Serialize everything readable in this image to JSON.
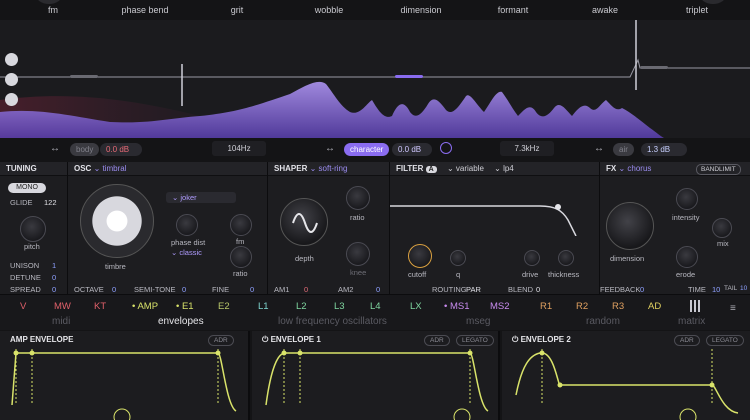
{
  "top_params": [
    "fm",
    "phase bend",
    "grit",
    "wobble",
    "dimension",
    "formant",
    "awake",
    "triplet"
  ],
  "spectrum": {
    "body_label": "body",
    "body_value": "0.0 dB",
    "freq1": "104Hz",
    "character_label": "character",
    "character_value": "0.0 dB",
    "freq2": "7.3kHz",
    "air_label": "air",
    "air_value": "1.3 dB"
  },
  "tuning": {
    "title": "TUNING",
    "mode": "MONO",
    "glide_label": "GLIDE",
    "glide_value": "122",
    "pitch_label": "pitch",
    "unison_label": "UNISON",
    "unison_value": "1",
    "detune_label": "DETUNE",
    "detune_value": "0",
    "spread_label": "SPREAD",
    "spread_value": "0"
  },
  "osc": {
    "title": "OSC",
    "type": "timbral",
    "preset": "joker",
    "timbre_label": "timbre",
    "phase_label": "phase dist",
    "phase_mode": "classic",
    "fm_label": "fm",
    "ratio_label": "ratio",
    "octave_label": "OCTAVE",
    "octave_value": "0",
    "semitone_label": "SEMI-TONE",
    "semitone_value": "0",
    "fine_label": "FINE",
    "fine_value": "0"
  },
  "shaper": {
    "title": "SHAPER",
    "type": "soft-ring",
    "depth_label": "depth",
    "ratio_label": "ratio",
    "knee_label": "knee",
    "am1_label": "AM1",
    "am1_value": "0",
    "am2_label": "AM2",
    "am2_value": "0"
  },
  "filter": {
    "title": "FILTER",
    "slot": "A",
    "type": "variable",
    "mode": "lp4",
    "cutoff_label": "cutoff",
    "q_label": "q",
    "drive_label": "drive",
    "thickness_label": "thickness",
    "routing_label": "ROUTING",
    "routing_value": "PAR",
    "blend_label": "BLEND",
    "blend_value": "0"
  },
  "fx": {
    "title": "FX",
    "type": "chorus",
    "bandlimit": "BANDLIMIT",
    "dimension_label": "dimension",
    "intensity_label": "intensity",
    "mix_label": "mix",
    "erode_label": "erode",
    "feedback_label": "FEEDBACK",
    "feedback_value": "0",
    "time_label": "TIME",
    "time_value": "10",
    "tail_label": "TAIL",
    "tail_value": "10"
  },
  "mod_tabs": [
    {
      "label": "V",
      "color": "#e0606a"
    },
    {
      "label": "MW",
      "color": "#e0606a"
    },
    {
      "label": "KT",
      "color": "#e0606a"
    },
    {
      "label": "• AMP",
      "color": "#d9e36a"
    },
    {
      "label": "• E1",
      "color": "#d9e36a"
    },
    {
      "label": "E2",
      "color": "#b9c76a"
    },
    {
      "label": "L1",
      "color": "#7fd6d0"
    },
    {
      "label": "L2",
      "color": "#7fd6a0"
    },
    {
      "label": "L3",
      "color": "#7fd6a0"
    },
    {
      "label": "L4",
      "color": "#7fd6a0"
    },
    {
      "label": "LX",
      "color": "#7fd6a0"
    },
    {
      "label": "• MS1",
      "color": "#c98cf0"
    },
    {
      "label": "MS2",
      "color": "#c98cf0"
    },
    {
      "label": "R1",
      "color": "#e0a060"
    },
    {
      "label": "R2",
      "color": "#e0a060"
    },
    {
      "label": "R3",
      "color": "#e0a060"
    },
    {
      "label": "AD",
      "color": "#e0d060"
    }
  ],
  "mod_categories": [
    "midi",
    "envelopes",
    "low frequency oscillators",
    "mseg",
    "random",
    "matrix"
  ],
  "envelopes": [
    {
      "title": "AMP ENVELOPE",
      "tags": [
        "ADR"
      ]
    },
    {
      "title": "ENVELOPE 1",
      "tags": [
        "ADR",
        "LEGATO"
      ]
    },
    {
      "title": "ENVELOPE 2",
      "tags": [
        "ADR",
        "LEGATO"
      ]
    }
  ],
  "colors": {
    "accent": "#8a6cf0",
    "env_line": "#d9e36a",
    "value": "#8ea0ff"
  }
}
